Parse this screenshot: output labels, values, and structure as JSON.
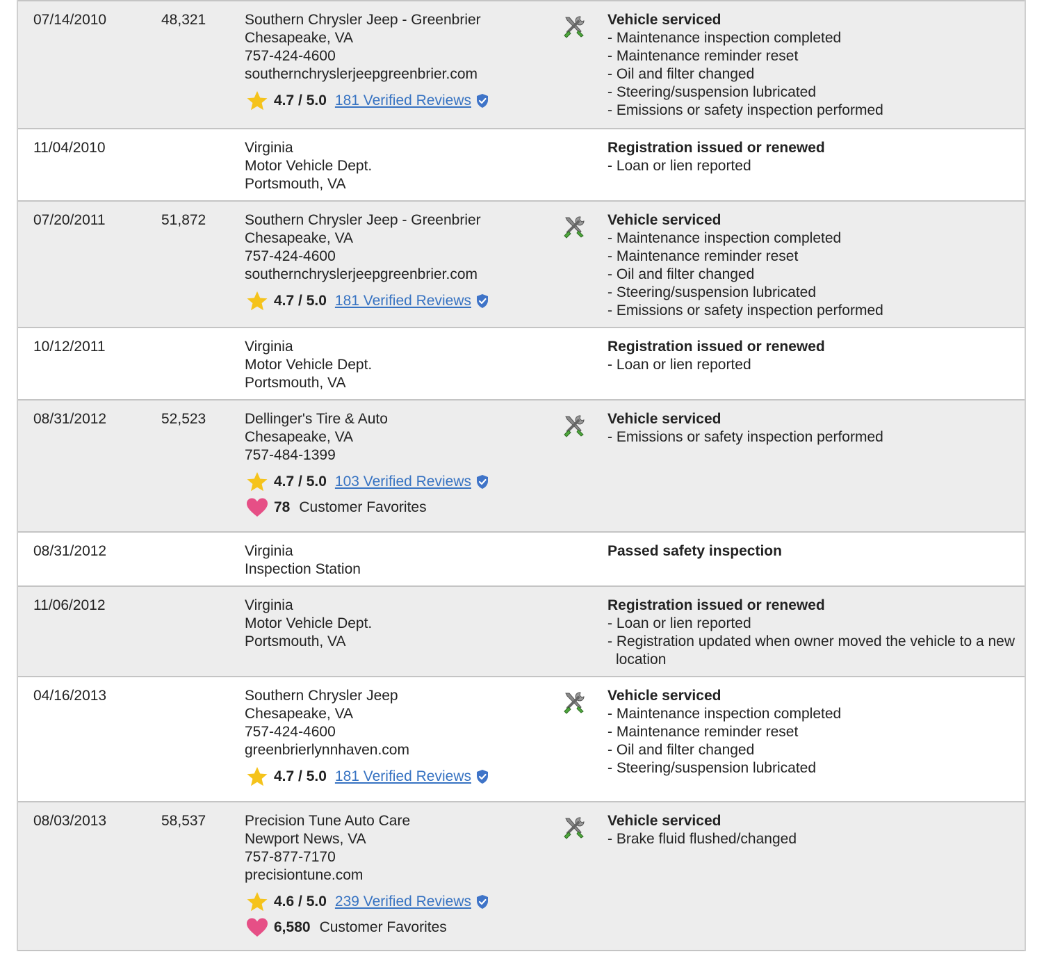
{
  "records": [
    {
      "date": "07/14/2010",
      "odometer": "48,321",
      "source": [
        "Southern Chrysler Jeep - Greenbrier",
        "Chesapeake, VA",
        "757-424-4600",
        "southernchryslerjeepgreenbrier.com"
      ],
      "rating": "4.7 / 5.0",
      "reviews": "181 Verified Reviews",
      "favorites": null,
      "favorites_label": null,
      "service": true,
      "heading": "Vehicle serviced",
      "details": [
        "- Maintenance inspection completed",
        "- Maintenance reminder reset",
        "- Oil and filter changed",
        "- Steering/suspension lubricated",
        "- Emissions or safety inspection performed"
      ]
    },
    {
      "date": "11/04/2010",
      "odometer": "",
      "source": [
        "Virginia",
        "Motor Vehicle Dept.",
        "Portsmouth, VA"
      ],
      "rating": null,
      "reviews": null,
      "favorites": null,
      "favorites_label": null,
      "service": false,
      "heading": "Registration issued or renewed",
      "details": [
        "- Loan or lien reported"
      ]
    },
    {
      "date": "07/20/2011",
      "odometer": "51,872",
      "source": [
        "Southern Chrysler Jeep - Greenbrier",
        "Chesapeake, VA",
        "757-424-4600",
        "southernchryslerjeepgreenbrier.com"
      ],
      "rating": "4.7 / 5.0",
      "reviews": "181 Verified Reviews",
      "favorites": null,
      "favorites_label": null,
      "service": true,
      "heading": "Vehicle serviced",
      "details": [
        "- Maintenance inspection completed",
        "- Maintenance reminder reset",
        "- Oil and filter changed",
        "- Steering/suspension lubricated",
        "- Emissions or safety inspection performed"
      ]
    },
    {
      "date": "10/12/2011",
      "odometer": "",
      "source": [
        "Virginia",
        "Motor Vehicle Dept.",
        "Portsmouth, VA"
      ],
      "rating": null,
      "reviews": null,
      "favorites": null,
      "favorites_label": null,
      "service": false,
      "heading": "Registration issued or renewed",
      "details": [
        "- Loan or lien reported"
      ]
    },
    {
      "date": "08/31/2012",
      "odometer": "52,523",
      "source": [
        "Dellinger's Tire & Auto",
        "Chesapeake, VA",
        "757-484-1399"
      ],
      "rating": "4.7 / 5.0",
      "reviews": "103 Verified Reviews",
      "favorites": "78",
      "favorites_label": "Customer Favorites",
      "service": true,
      "heading": "Vehicle serviced",
      "details": [
        "- Emissions or safety inspection performed"
      ]
    },
    {
      "date": "08/31/2012",
      "odometer": "",
      "source": [
        "Virginia",
        "Inspection Station"
      ],
      "rating": null,
      "reviews": null,
      "favorites": null,
      "favorites_label": null,
      "service": false,
      "heading": "Passed safety inspection",
      "details": []
    },
    {
      "date": "11/06/2012",
      "odometer": "",
      "source": [
        "Virginia",
        "Motor Vehicle Dept.",
        "Portsmouth, VA"
      ],
      "rating": null,
      "reviews": null,
      "favorites": null,
      "favorites_label": null,
      "service": false,
      "heading": "Registration issued or renewed",
      "details": [
        "- Loan or lien reported",
        "- Registration updated when owner moved the vehicle to a new location"
      ]
    },
    {
      "date": "04/16/2013",
      "odometer": "",
      "source": [
        "Southern Chrysler Jeep",
        "Chesapeake, VA",
        "757-424-4600",
        "greenbrierlynnhaven.com"
      ],
      "rating": "4.7 / 5.0",
      "reviews": "181 Verified Reviews",
      "favorites": null,
      "favorites_label": null,
      "service": true,
      "heading": "Vehicle serviced",
      "details": [
        "- Maintenance inspection completed",
        "- Maintenance reminder reset",
        "- Oil and filter changed",
        "- Steering/suspension lubricated"
      ]
    },
    {
      "date": "08/03/2013",
      "odometer": "58,537",
      "source": [
        "Precision Tune Auto Care",
        "Newport News, VA",
        "757-877-7170",
        "precisiontune.com"
      ],
      "rating": "4.6 / 5.0",
      "reviews": "239 Verified Reviews",
      "favorites": "6,580",
      "favorites_label": "Customer Favorites",
      "service": true,
      "heading": "Vehicle serviced",
      "details": [
        "- Brake fluid flushed/changed"
      ]
    }
  ],
  "colors": {
    "row_shaded": "#ededed",
    "row_white": "#ffffff",
    "link": "#3773c2",
    "star": "#f5c31b",
    "heart": "#e64f86",
    "shield": "#3f74c8"
  },
  "icons": {
    "service": "wrench-screwdriver-icon",
    "rating": "star-icon",
    "verified": "shield-check-icon",
    "favorites": "heart-icon"
  }
}
